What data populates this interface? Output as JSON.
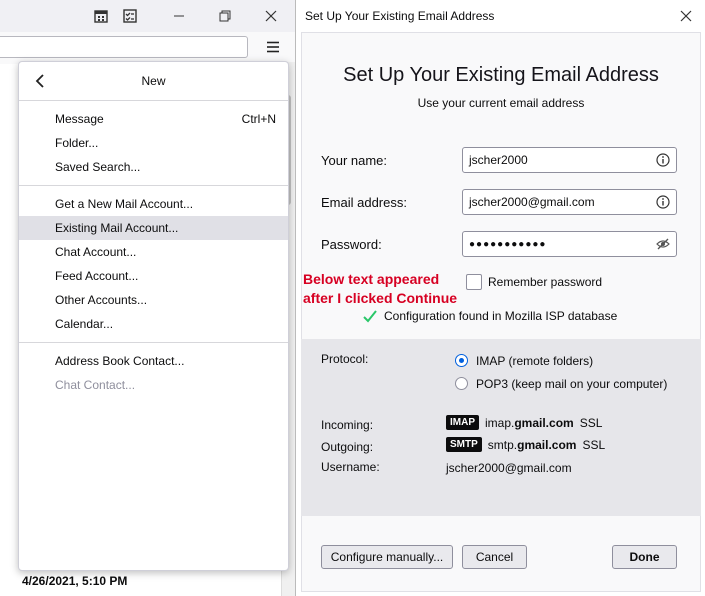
{
  "main_window": {
    "date_label": "4/26/2021, 5:10 PM",
    "icons": [
      "calendar-icon",
      "tasks-icon",
      "minimize-icon",
      "restore-icon",
      "close-icon",
      "hamburger-menu-icon"
    ]
  },
  "menu": {
    "title": "New",
    "items": [
      {
        "label": "Message",
        "shortcut": "Ctrl+N"
      },
      {
        "label": "Folder..."
      },
      {
        "label": "Saved Search..."
      },
      {
        "label": "Get a New Mail Account..."
      },
      {
        "label": "Existing Mail Account...",
        "highlighted": true
      },
      {
        "label": "Chat Account..."
      },
      {
        "label": "Feed Account..."
      },
      {
        "label": "Other Accounts..."
      },
      {
        "label": "Calendar..."
      },
      {
        "label": "Address Book Contact..."
      },
      {
        "label": "Chat Contact...",
        "disabled": true
      }
    ]
  },
  "dialog": {
    "window_title": "Set Up Your Existing Email Address",
    "heading": "Set Up Your Existing Email Address",
    "subheading": "Use your current email address",
    "fields": {
      "name_label": "Your name:",
      "name_value": "jscher2000",
      "email_label": "Email address:",
      "email_value": "jscher2000@gmail.com",
      "password_label": "Password:",
      "password_value": "●●●●●●●●●●●"
    },
    "remember_label": "Remember password",
    "remember_checked": false,
    "annotation": "Below text appeared after I clicked Continue",
    "config_status": "Configuration found in Mozilla ISP database",
    "protocol_label": "Protocol:",
    "protocol_options": [
      "IMAP (remote folders)",
      "POP3 (keep mail on your computer)"
    ],
    "protocol_selected": "IMAP (remote folders)",
    "incoming_label": "Incoming:",
    "incoming_badge": "IMAP",
    "incoming_host_prefix": "imap.",
    "incoming_host_bold": "gmail.com",
    "incoming_security": "SSL",
    "outgoing_label": "Outgoing:",
    "outgoing_badge": "SMTP",
    "outgoing_host_prefix": "smtp.",
    "outgoing_host_bold": "gmail.com",
    "outgoing_security": "SSL",
    "username_label": "Username:",
    "username_value": "jscher2000@gmail.com",
    "buttons": {
      "configure": "Configure manually...",
      "cancel": "Cancel",
      "done": "Done"
    },
    "colors": {
      "accent": "#0060df",
      "annotation": "#d70022",
      "check": "#2ac769"
    }
  }
}
